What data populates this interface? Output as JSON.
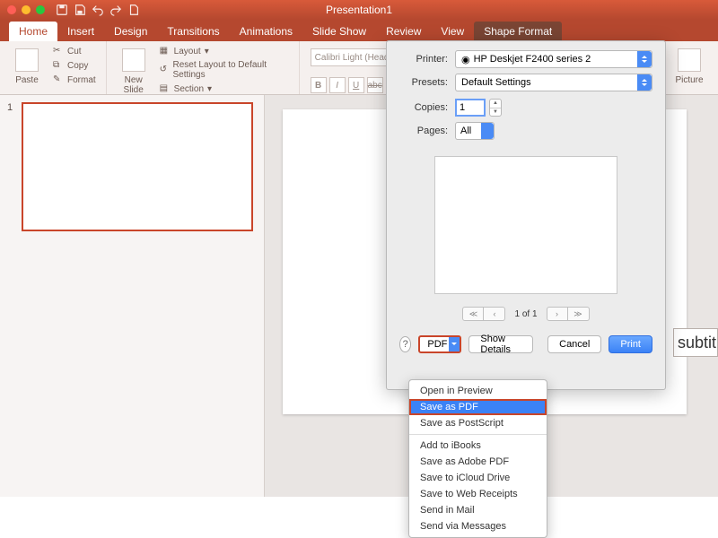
{
  "titlebar": {
    "doc_title": "Presentation1"
  },
  "tabs": {
    "home": "Home",
    "insert": "Insert",
    "design": "Design",
    "transitions": "Transitions",
    "animations": "Animations",
    "slideshow": "Slide Show",
    "review": "Review",
    "view": "View",
    "shape_format": "Shape Format"
  },
  "ribbon": {
    "paste": "Paste",
    "cut": "Cut",
    "copy": "Copy",
    "format": "Format",
    "new_slide": "New\nSlide",
    "layout": "Layout",
    "reset": "Reset Layout to Default Settings",
    "section": "Section",
    "font_name": "Calibri Light (Headi…",
    "picture": "Picture"
  },
  "thumbs": {
    "num": "1"
  },
  "canvas": {
    "subtitle": "subtit"
  },
  "print": {
    "printer_lbl": "Printer:",
    "printer_val": "HP Deskjet F2400 series 2",
    "presets_lbl": "Presets:",
    "presets_val": "Default Settings",
    "copies_lbl": "Copies:",
    "copies_val": "1",
    "pages_lbl": "Pages:",
    "pages_val": "All",
    "pager_txt": "1 of 1",
    "help": "?",
    "pdf_label": "PDF",
    "show_details": "Show Details",
    "cancel": "Cancel",
    "print": "Print"
  },
  "pdf_menu": {
    "open_preview": "Open in Preview",
    "save_pdf": "Save as PDF",
    "save_ps": "Save as PostScript",
    "add_ibooks": "Add to iBooks",
    "save_adobe": "Save as Adobe PDF",
    "save_icloud": "Save to iCloud Drive",
    "save_web": "Save to Web Receipts",
    "send_mail": "Send in Mail",
    "send_msg": "Send via Messages"
  }
}
